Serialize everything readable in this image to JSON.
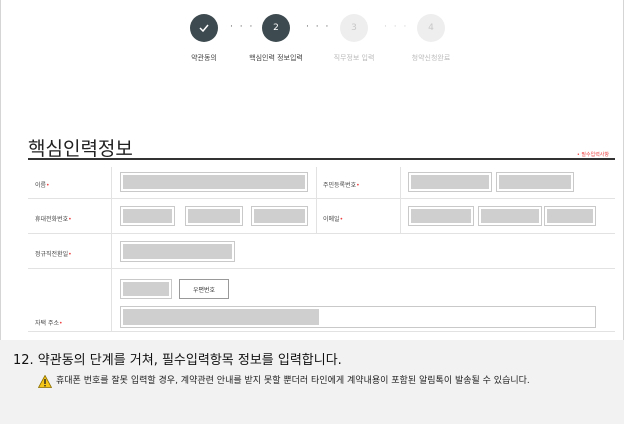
{
  "stepper": {
    "steps": [
      {
        "number": "",
        "label": "약관동의",
        "state": "done"
      },
      {
        "number": "2",
        "label": "핵심인력 정보입력",
        "state": "active"
      },
      {
        "number": "3",
        "label": "직무정보 입력",
        "state": "pending"
      },
      {
        "number": "4",
        "label": "청약신청완료",
        "state": "pending"
      }
    ],
    "separator": "· · ·",
    "done_icon": "check-icon"
  },
  "section": {
    "title": "핵심인력정보",
    "required_note": "• 필수입력사항"
  },
  "form": {
    "required_mark": "•",
    "fields": {
      "name": "이름",
      "rrn": "주민등록번호",
      "phone": "휴대전화번호",
      "email": "이메일",
      "hire_date": "정규직전환일",
      "address": "자택 주소"
    },
    "zip_button": "우편번호"
  },
  "caption": {
    "main": "12.  약관동의 단계를 거쳐, 필수입력항목 정보를 입력합니다.",
    "warning_icon": "warning-icon",
    "note": "휴대폰 번호를 잘못 입력할 경우, 계약관련 안내를 받지 못할 뿐더러 타인에게 계약내용이 포함된 알림톡이 발송될 수 있습니다."
  },
  "colors": {
    "active_step": "#3d4a4f",
    "pending_step": "#eeeeee",
    "required": "#e44444",
    "warning": "#f5c518"
  }
}
